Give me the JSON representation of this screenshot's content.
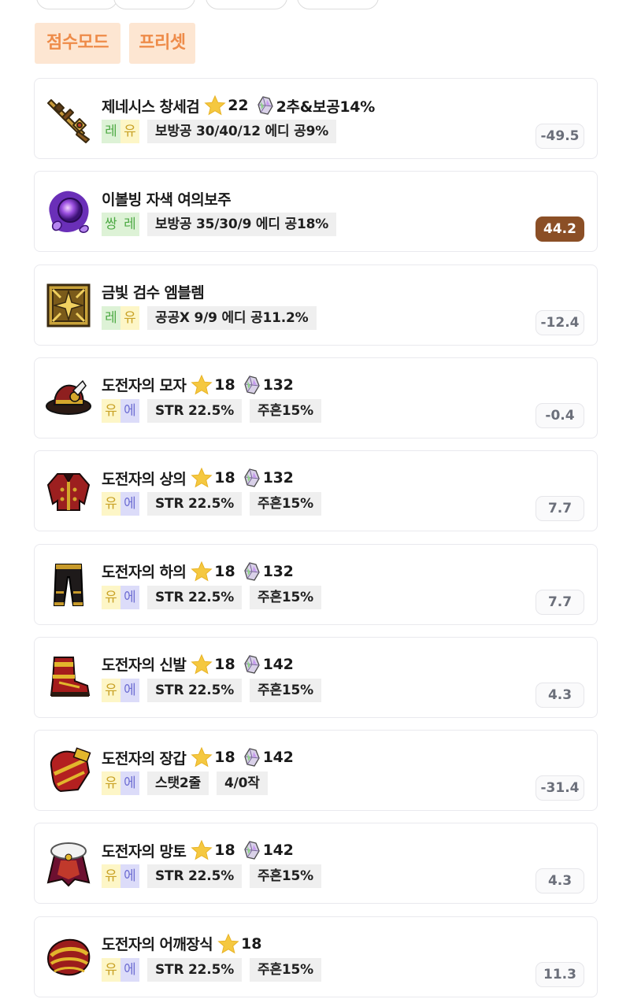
{
  "chips": {
    "score_mode": "점수모드",
    "preset": "프리셋"
  },
  "colors": {
    "chip_bg": "#fde6d2",
    "chip_text": "#ee8b49",
    "highlight_score_bg": "#8b4f26"
  },
  "items": [
    {
      "name": "제네시스 창세검",
      "star": "22",
      "gem": "2추&보공14%",
      "pot": [
        "레",
        "유"
      ],
      "opts": [
        "보방공 30/40/12 에디 공9%"
      ],
      "score": "-49.5",
      "highlight": false,
      "icon": "sword-icon"
    },
    {
      "name": "이볼빙 자색 여의보주",
      "star": "",
      "gem": "",
      "pot": [
        "쌍",
        "레"
      ],
      "opts": [
        "보방공 35/30/9 에디 공18%"
      ],
      "score": "44.2",
      "highlight": true,
      "icon": "orb-icon"
    },
    {
      "name": "금빛 검수 엠블렘",
      "star": "",
      "gem": "",
      "pot": [
        "레",
        "유"
      ],
      "opts": [
        "공공X 9/9 에디 공11.2%"
      ],
      "score": "-12.4",
      "highlight": false,
      "icon": "emblem-icon"
    },
    {
      "name": "도전자의 모자",
      "star": "18",
      "gem": "132",
      "pot": [
        "유",
        "에"
      ],
      "opts": [
        "STR 22.5%",
        "주흔15%"
      ],
      "score": "-0.4",
      "highlight": false,
      "icon": "hat-icon"
    },
    {
      "name": "도전자의 상의",
      "star": "18",
      "gem": "132",
      "pot": [
        "유",
        "에"
      ],
      "opts": [
        "STR 22.5%",
        "주흔15%"
      ],
      "score": "7.7",
      "highlight": false,
      "icon": "top-icon"
    },
    {
      "name": "도전자의 하의",
      "star": "18",
      "gem": "132",
      "pot": [
        "유",
        "에"
      ],
      "opts": [
        "STR 22.5%",
        "주흔15%"
      ],
      "score": "7.7",
      "highlight": false,
      "icon": "pants-icon"
    },
    {
      "name": "도전자의 신발",
      "star": "18",
      "gem": "142",
      "pot": [
        "유",
        "에"
      ],
      "opts": [
        "STR 22.5%",
        "주흔15%"
      ],
      "score": "4.3",
      "highlight": false,
      "icon": "shoes-icon"
    },
    {
      "name": "도전자의 장갑",
      "star": "18",
      "gem": "142",
      "pot": [
        "유",
        "에"
      ],
      "opts": [
        "스탯2줄",
        "4/0작"
      ],
      "score": "-31.4",
      "highlight": false,
      "icon": "gloves-icon"
    },
    {
      "name": "도전자의 망토",
      "star": "18",
      "gem": "142",
      "pot": [
        "유",
        "에"
      ],
      "opts": [
        "STR 22.5%",
        "주흔15%"
      ],
      "score": "4.3",
      "highlight": false,
      "icon": "cape-icon"
    },
    {
      "name": "도전자의 어깨장식",
      "star": "18",
      "gem": "",
      "pot": [
        "유",
        "에"
      ],
      "opts": [
        "STR 22.5%",
        "주흔15%"
      ],
      "score": "11.3",
      "highlight": false,
      "icon": "shoulder-icon"
    }
  ]
}
